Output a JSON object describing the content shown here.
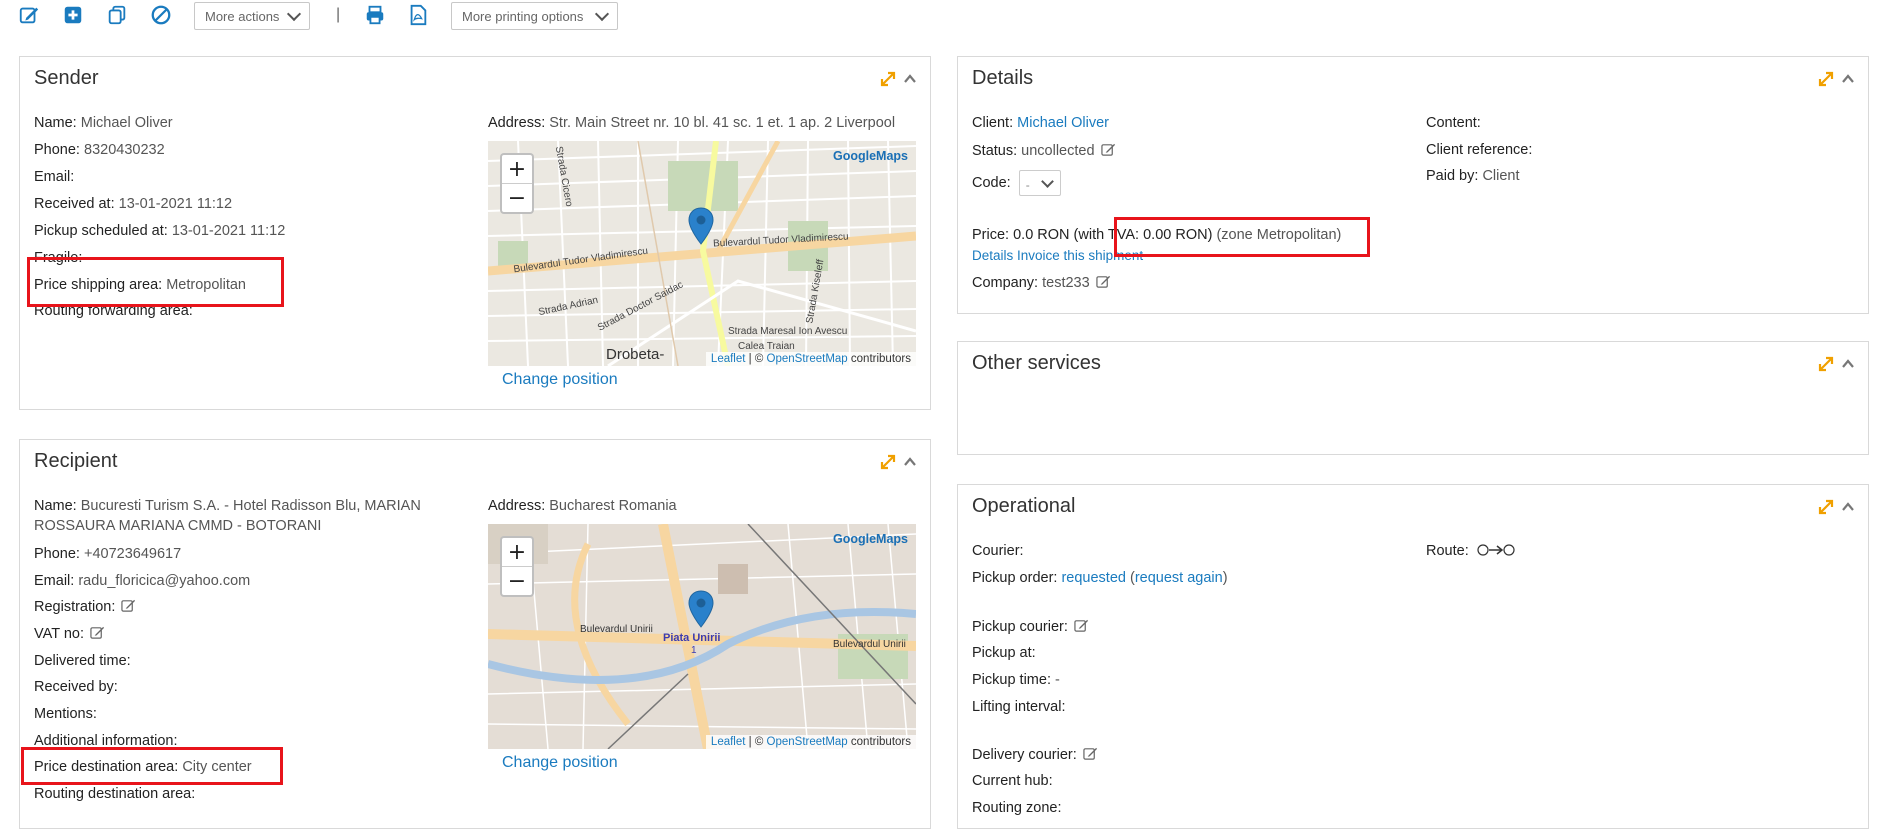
{
  "toolbar": {
    "more_actions": "More actions",
    "separator": "|",
    "more_printing": "More printing options",
    "icons": [
      "edit-icon",
      "add-icon",
      "copy-icon",
      "cancel-icon",
      "print-icon",
      "pdf-icon"
    ]
  },
  "sender": {
    "title": "Sender",
    "name_label": "Name:",
    "name": "Michael Oliver",
    "phone_label": "Phone:",
    "phone": "8320430232",
    "email_label": "Email:",
    "received_label": "Received at:",
    "received": "13-01-2021 11:12",
    "pickup_label": "Pickup scheduled at:",
    "pickup": "13-01-2021 11:12",
    "fragile_label": "Fragile:",
    "price_area_label": "Price shipping area:",
    "price_area": "Metropolitan",
    "routing_label": "Routing forwarding area:",
    "address_label": "Address:",
    "address": "Str. Main Street nr. 10 bl. 41 sc. 1 et. 1 ap. 2 Liverpool",
    "map": {
      "google": "GoogleMaps",
      "street1": "Bulevardul Tudor Vladimirescu",
      "street2": "Bulevardul Tudor Vladimirescu",
      "street3": "Strada Adrian",
      "street4": "Strada Doctor Saidac",
      "street5": "Strada Maresal Ion Avescu",
      "street6": "Calea Traian",
      "street7": "Strada Cicero",
      "street8": "Strada Kiseleff",
      "city": "Drobeta-",
      "attr_leaflet": "Leaflet",
      "attr_sep": "| ©",
      "attr_osm": "OpenStreetMap",
      "attr_contrib": "contributors"
    },
    "change_position": "Change position"
  },
  "recipient": {
    "title": "Recipient",
    "name_label": "Name:",
    "name_line1": "Bucuresti Turism S.A. - Hotel Radisson Blu, MARIAN",
    "name_line2": "ROSSAURA MARIANA CMMD - BOTORANI",
    "phone_label": "Phone:",
    "phone": "+40723649617",
    "email_label": "Email:",
    "email": "radu_floricica@yahoo.com",
    "registration_label": "Registration:",
    "vat_label": "VAT no:",
    "delivered_label": "Delivered time:",
    "receivedby_label": "Received by:",
    "mentions_label": "Mentions:",
    "additional_label": "Additional information:",
    "price_dest_label": "Price destination area:",
    "price_dest": "City center",
    "routing_dest_label": "Routing destination area:",
    "address_label": "Address:",
    "address": "Bucharest Romania",
    "map": {
      "google": "GoogleMaps",
      "street1": "Bulevardul Unirii",
      "street2": "Bulevardul Unirii",
      "place": "Piata Unirii",
      "place_num": "1",
      "attr_leaflet": "Leaflet",
      "attr_sep": "| ©",
      "attr_osm": "OpenStreetMap",
      "attr_contrib": "contributors"
    },
    "change_position": "Change position"
  },
  "details": {
    "title": "Details",
    "client_label": "Client:",
    "client": "Michael Oliver",
    "status_label": "Status:",
    "status": "uncollected",
    "code_label": "Code:",
    "code_value": "-",
    "price_label": "Price:",
    "price": "0.0 RON (with TVA: 0.00 RON)",
    "zone": "(zone Metropolitan)",
    "details_link": "Details",
    "invoice_link": "Invoice this shipment",
    "company_label": "Company:",
    "company": "test233",
    "content_label": "Content:",
    "client_ref_label": "Client reference:",
    "paid_label": "Paid by:",
    "paid": "Client"
  },
  "other_services": {
    "title": "Other services"
  },
  "operational": {
    "title": "Operational",
    "courier_label": "Courier:",
    "pickup_order_label": "Pickup order:",
    "pickup_order": "requested",
    "request_again": "request again",
    "pickup_courier_label": "Pickup courier:",
    "pickup_at_label": "Pickup at:",
    "pickup_time_label": "Pickup time:",
    "pickup_time": "-",
    "lifting_label": "Lifting interval:",
    "delivery_courier_label": "Delivery courier:",
    "current_hub_label": "Current hub:",
    "routing_zone_label": "Routing zone:",
    "route_label": "Route:"
  },
  "colors": {
    "accent_link": "#1a7bbf",
    "highlight": "#e8141b",
    "expand": "#f0a000"
  }
}
